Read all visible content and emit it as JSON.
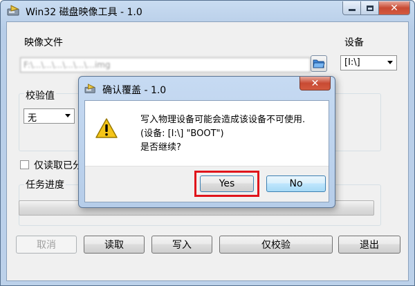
{
  "main_window": {
    "title": "Win32 磁盘映像工具 - 1.0",
    "image_file_label": "映像文件",
    "image_file_value": "F:\\...\\...\\...\\...\\...\\...img",
    "device_label": "设备",
    "device_value": "[I:\\]",
    "hash_label": "校验值",
    "hash_value": "无",
    "readonly_label": "仅读取已分",
    "progress_label": "任务进度",
    "progress_value": 0,
    "buttons": {
      "cancel": "取消",
      "read": "读取",
      "write": "写入",
      "verify": "仅校验",
      "exit": "退出"
    }
  },
  "dialog": {
    "title": "确认覆盖 - 1.0",
    "message_line1": "写入物理设备可能会造成该设备不可使用.",
    "message_line2": "(设备: [I:\\] \"BOOT\")",
    "message_line3": "是否继续?",
    "yes_label": "Yes",
    "no_label": "No"
  },
  "colors": {
    "highlight": "#e0141b",
    "titlebar": "#c9dcf1",
    "close_button": "#c84a33"
  },
  "icons": [
    "app-disk-icon",
    "folder-open-icon",
    "warning-icon",
    "close-icon",
    "minimize-icon",
    "maximize-icon",
    "dropdown-arrow-icon"
  ]
}
